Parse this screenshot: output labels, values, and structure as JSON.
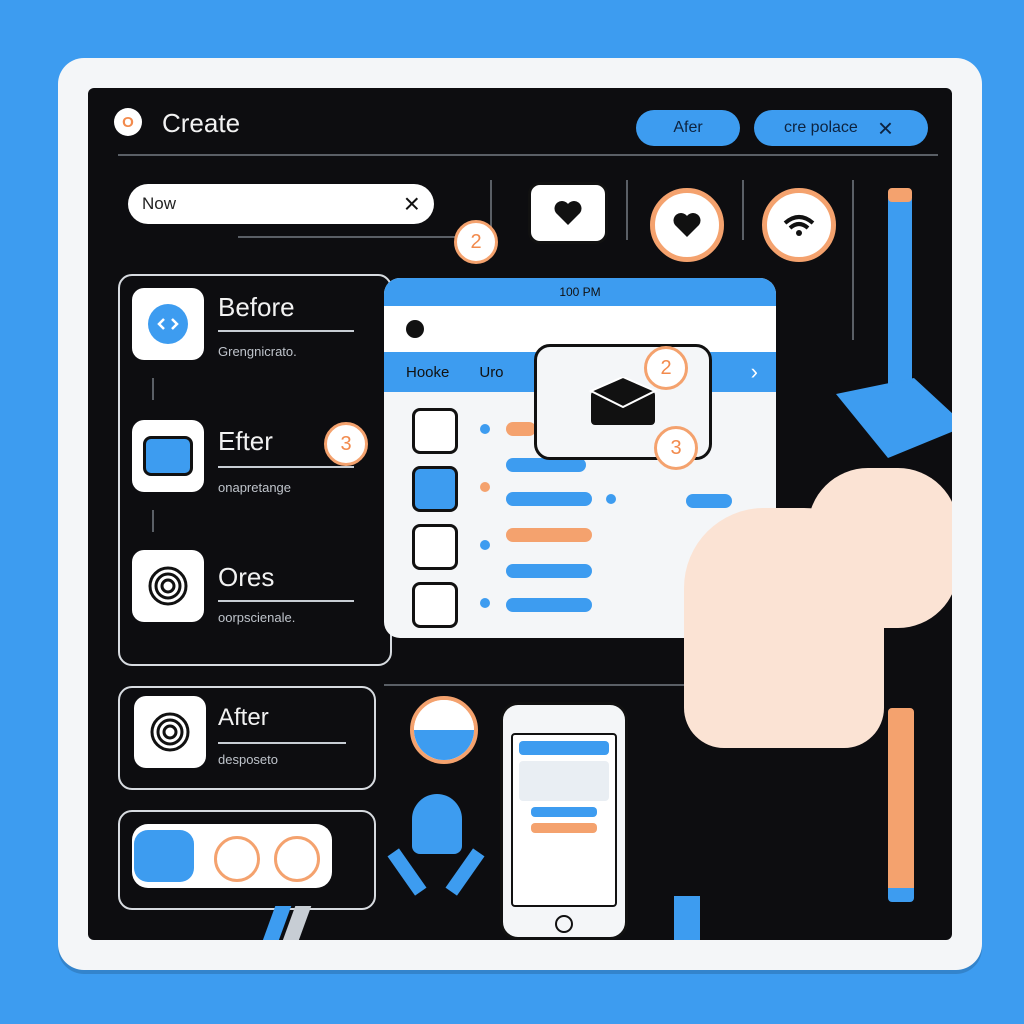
{
  "header": {
    "create_label": "Create",
    "create_icon_text": "O"
  },
  "top_buttons": {
    "after_label": "Afer",
    "place_label": "cre polace",
    "close_glyph": "×"
  },
  "search": {
    "value": "Now",
    "clear_glyph": "×"
  },
  "badges": {
    "b2": "2",
    "b3": "3",
    "b2b": "2",
    "b3b": "3"
  },
  "list": [
    {
      "title": "Before",
      "subtitle": "Grengnicrato."
    },
    {
      "title": "Efter",
      "subtitle": "onapretange"
    },
    {
      "title": "Ores",
      "subtitle": "oorpscienale."
    }
  ],
  "after_card": {
    "title": "After",
    "subtitle": "desposeto"
  },
  "window": {
    "time": "100 PM",
    "col1": "Hooke",
    "col2": "Uro",
    "nav_arrow": "›"
  },
  "colors": {
    "accent": "#3d9cf0",
    "orange": "#f4a26e",
    "dark": "#0d0d10"
  }
}
